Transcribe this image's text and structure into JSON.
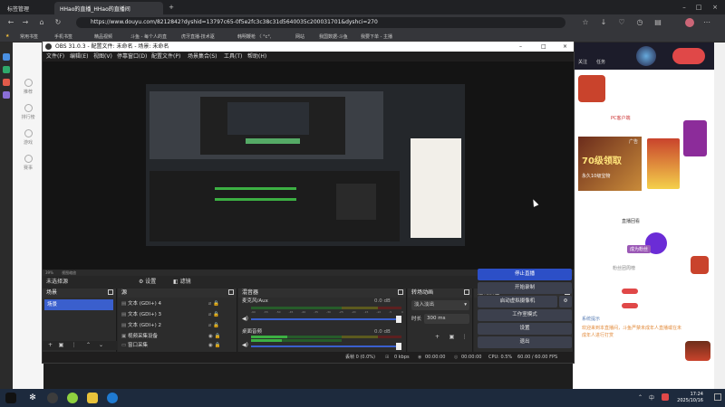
{
  "browser": {
    "tab_group": "标签管理",
    "active_tab": "HHao的直播_HHao的直播间",
    "url": "https://www.douyu.com/8212842?dyshid=13797c65-0f5e2fc3c38c31d5640035c200031701&dyshci=270",
    "bookmarks": [
      "常用书签",
      "手机书签",
      "精品视频",
      "斗鱼 - 每个人的直",
      "虎牙直播-技术驱",
      "韩明鞭枪 〈 °c°,",
      "网站",
      "我国数据-斗鱼",
      "我要下单 - 主播"
    ]
  },
  "site": {
    "left_nav": [
      "推荐",
      "排行榜",
      "游戏",
      "赛事"
    ],
    "right": {
      "follow": "关注",
      "task": "任务",
      "pc_client": "PC客户端",
      "ad_label": "广告",
      "ad_title": "70级领取",
      "ad_sub": "永久10级宝物",
      "hot_rank": "直播回看",
      "fans_week": "粉丝团周榜",
      "badge": "成为粉丝",
      "chat_header": "系统提示",
      "chat_text": "欢迎来到本直播间，斗鱼严禁未成年人直播或在未成年人进行打赏"
    }
  },
  "obs": {
    "title": "OBS 31.0.3 - 配置文件: 未命名 - 场景: 未命名",
    "menu": [
      "文件(F)",
      "编辑(E)",
      "视图(V)",
      "停靠窗口(D)",
      "配置文件(P)",
      "场景集合(S)",
      "工具(T)",
      "帮助(H)"
    ],
    "zoom": "39%",
    "zoom_label": "视图缩放",
    "source_bar": {
      "no_source": "未选择源",
      "properties": "设置",
      "filters": "滤镜"
    },
    "scenes": {
      "title": "场景",
      "items": [
        "场景"
      ]
    },
    "sources": {
      "title": "源",
      "items": [
        "文本 (GDI+) 4",
        "文本 (GDI+) 3",
        "文本 (GDI+) 2",
        "视频采集设备",
        "窗口采集",
        "显示器采集"
      ]
    },
    "mixer": {
      "title": "混音器",
      "ch1": "麦克风/Aux",
      "ch1_db": "0.0 dB",
      "ch2": "桌面音频",
      "ch2_db": "0.0 dB",
      "scale": [
        "-60",
        "-55",
        "-50",
        "-45",
        "-40",
        "-35",
        "-30",
        "-25",
        "-20",
        "-15",
        "-10",
        "-5",
        "0"
      ]
    },
    "transitions": {
      "title": "转场动画",
      "type": "淡入淡出",
      "duration_label": "时长",
      "duration": "300 ms"
    },
    "controls": {
      "title": "控制按钮",
      "buttons": [
        "停止直播",
        "开始录制",
        "启动虚拟摄像机",
        "工作室模式",
        "设置",
        "退出"
      ]
    },
    "status": {
      "dropped": "丢帧 0 (0.0%)",
      "bitrate": "0 kbps",
      "live_time": "00:00:00",
      "rec_time": "00:00:00",
      "cpu": "CPU: 0.5%",
      "fps": "60.00 / 60.00 FPS"
    }
  },
  "taskbar": {
    "time": "17:24",
    "date": "2025/10/16",
    "lang": "中"
  },
  "colors": {
    "obs_accent": "#2c4fc7",
    "meter_green": "#3cb043",
    "meter_yellow": "#c8b400",
    "meter_red": "#c0392b"
  }
}
